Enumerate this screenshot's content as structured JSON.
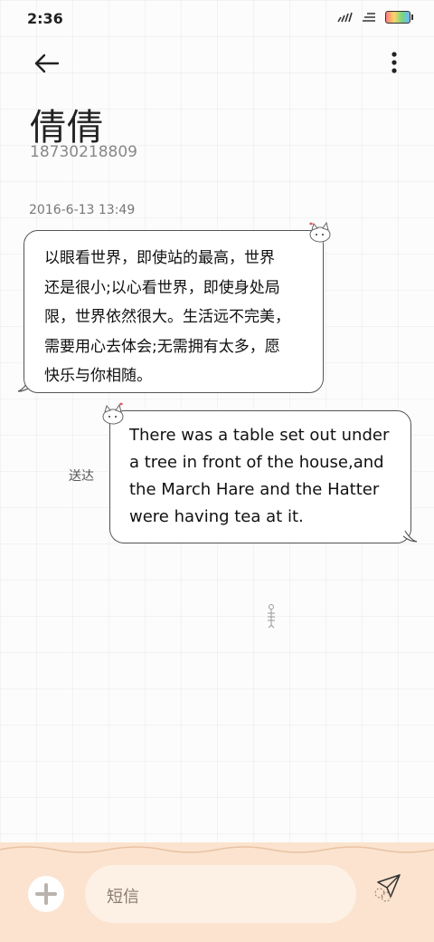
{
  "status_bar": {
    "time": "2:36",
    "icons": [
      "signal-icon",
      "wifi-icon",
      "battery-icon"
    ]
  },
  "top_bar": {
    "back_icon": "arrow-left-icon",
    "more_icon": "more-vertical-icon"
  },
  "contact": {
    "name": "倩倩",
    "number": "18730218809"
  },
  "conversation": {
    "timestamp": "2016-6-13 13:49",
    "messages": [
      {
        "direction": "incoming",
        "lines": [
          "以眼看世界，即使站的最高，世界",
          "还是很小;以心看世界，即使身处局",
          "限，世界依然很大。生活远不完美，",
          "需要用心去体会;无需拥有太多，愿",
          "快乐与你相随。"
        ]
      },
      {
        "direction": "outgoing",
        "status": "送达",
        "lines": [
          "There was a table set out under",
          "a tree in front of the house,and",
          "the March Hare and the Hatter",
          "were having tea at it."
        ]
      }
    ]
  },
  "composer": {
    "placeholder": "短信",
    "add_icon": "plus-circle-icon",
    "send_icon": "paper-plane-icon"
  },
  "colors": {
    "bubble_border": "#555555",
    "bottom_bar": "#fbe3cf",
    "input_bg": "#fdf1e6"
  }
}
